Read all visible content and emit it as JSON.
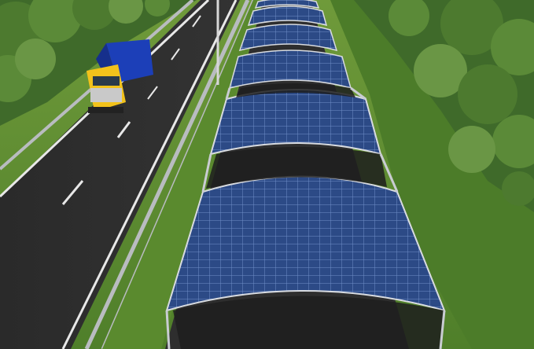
{
  "scene": {
    "subject": "solar-panel-canopy-over-highway",
    "palette": {
      "grass": "#5a8a2e",
      "grass_dark": "#3f6a26",
      "asphalt": "#2b2b2b",
      "asphalt_light": "#3a3a3a",
      "lane_marking": "#e8e8e8",
      "guardrail": "#b9bcc0",
      "solar_panel": "#2c4a86",
      "solar_panel_light": "#4f72b5",
      "frame": "#d8dbe0",
      "truck_cab": "#f2c21b",
      "truck_trailer": "#1c3fb8",
      "foliage": "#4d7a2f",
      "foliage_light": "#8fb06a",
      "sky": "#cfe3c0"
    },
    "canopy_segment_count": 7,
    "vehicle_count": 1
  }
}
